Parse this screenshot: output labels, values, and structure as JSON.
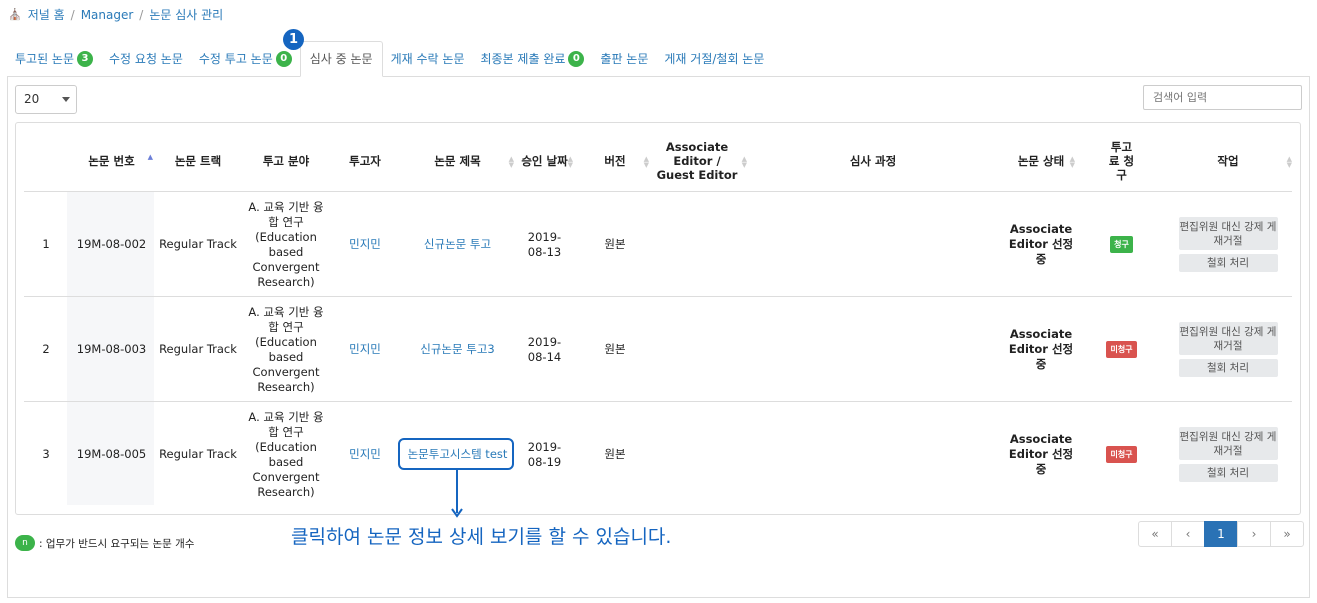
{
  "breadcrumb": {
    "home": "저널 홈",
    "manager": "Manager",
    "current": "논문 심사 관리"
  },
  "tabs": [
    {
      "label": "투고된 논문",
      "badge": "3"
    },
    {
      "label": "수정 요청 논문",
      "badge": null
    },
    {
      "label": "수정 투고 논문",
      "badge": "0"
    },
    {
      "label": "심사 중 논문",
      "badge": null,
      "active": true
    },
    {
      "label": "게재 수락 논문",
      "badge": null
    },
    {
      "label": "최종본 제출 완료",
      "badge": "0"
    },
    {
      "label": "출판 논문",
      "badge": null
    },
    {
      "label": "게재 거절/철회 논문",
      "badge": null
    }
  ],
  "marker": "1",
  "page_size": "20",
  "search": {
    "placeholder": "검색어 입력"
  },
  "columns": [
    "논문 번호",
    "논문 트랙",
    "투고 분야",
    "투고자",
    "논문 제목",
    "승인 날짜",
    "버전",
    "Associate Editor / Guest Editor",
    "심사 과정",
    "논문 상태",
    "투고료 청구",
    "작업"
  ],
  "rows": [
    {
      "no": "1",
      "paper_id": "19M-08-002",
      "track": "Regular Track",
      "field": "A. 교육 기반 융합 연구(Education based Convergent Research)",
      "author": "민지민",
      "title": "신규논문 투고",
      "date": "2019-08-13",
      "version": "원본",
      "status": "Associate Editor 선정 중",
      "fee": "청구",
      "fee_color": "#3cb34a",
      "action1": "편집위원 대신 강제 게재거절",
      "action2": "철회 처리"
    },
    {
      "no": "2",
      "paper_id": "19M-08-003",
      "track": "Regular Track",
      "field": "A. 교육 기반 융합 연구(Education based Convergent Research)",
      "author": "민지민",
      "title": "신규논문 투고3",
      "date": "2019-08-14",
      "version": "원본",
      "status": "Associate Editor 선정 중",
      "fee": "미청구",
      "fee_color": "#d9534f",
      "action1": "편집위원 대신 강제 게재거절",
      "action2": "철회 처리"
    },
    {
      "no": "3",
      "paper_id": "19M-08-005",
      "track": "Regular Track",
      "field": "A. 교육 기반 융합 연구(Education based Convergent Research)",
      "author": "민지민",
      "title": "논문투고시스템 test",
      "date": "2019-08-19",
      "version": "원본",
      "status": "Associate Editor 선정 중",
      "fee": "미청구",
      "fee_color": "#d9534f",
      "action1": "편집위원 대신 강제 게재거절",
      "action2": "철회 처리"
    }
  ],
  "callout": "클릭하여 논문 정보 상세 보기를 할 수 있습니다.",
  "legend": {
    "badge": "n",
    "text": ": 업무가 반드시 요구되는 논문 개수"
  },
  "pagination": {
    "first": "«",
    "prev": "‹",
    "page": "1",
    "next": "›",
    "last": "»"
  }
}
